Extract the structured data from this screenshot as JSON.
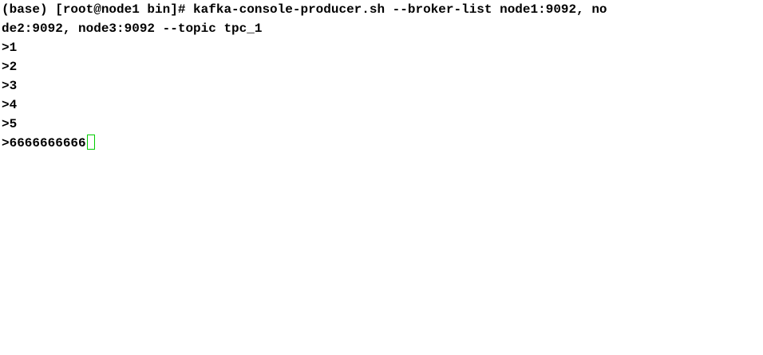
{
  "terminal": {
    "command_line_1": "(base) [root@node1 bin]# kafka-console-producer.sh --broker-list node1:9092, no",
    "command_line_2": "de2:9092, node3:9092 --topic tpc_1",
    "output": [
      ">1",
      ">2",
      ">3",
      ">4",
      ">5"
    ],
    "current_input": ">6666666666",
    "cursor_color": "#00cc00"
  }
}
